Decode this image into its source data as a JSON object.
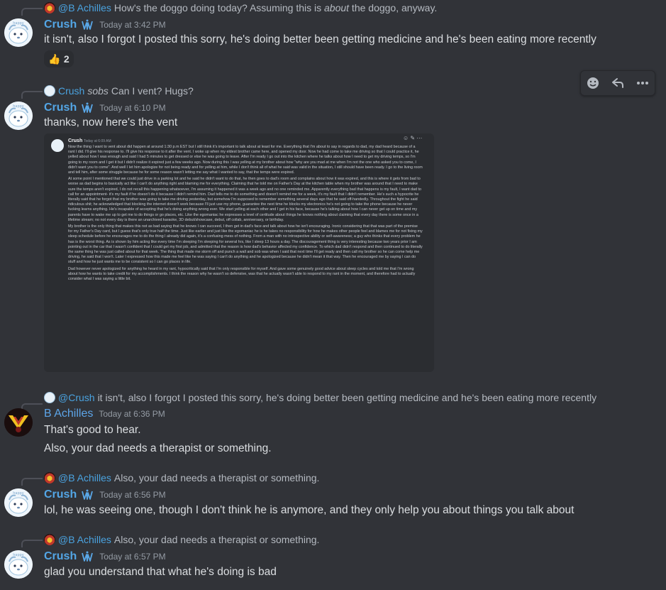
{
  "messages": [
    {
      "reply": {
        "author": "@B Achilles",
        "text_pre": "How's the doggo doing today? Assuming this is ",
        "text_em": "about",
        "text_post": " the doggo, anyway."
      },
      "author": "Crush",
      "timestamp": "Today at 3:42 PM",
      "text": "it isn't, also I forgot I posted this sorry, he's doing better been getting medicine and he's been eating more recently",
      "reaction": {
        "emoji": "👍",
        "count": "2"
      }
    },
    {
      "reply": {
        "author": "Crush",
        "text_em": "sobs",
        "text_post": " Can I vent? Hugs?"
      },
      "author": "Crush",
      "timestamp": "Today at 6:10 PM",
      "text": "thanks, now here's the vent",
      "attachment": {
        "author": "Crush",
        "timestamp": "Today at 6:09 AM",
        "paragraphs": [
          "Now the thing I want to vent about did happen at around 1:30 p.m EST but I still think it's important to talk about at least for me. Everything that I'm about to say in regards to dad, my dad heard because of a rant I did. I'll give his response to. I'll give his response to it after the vent. I woke up when my eldest brother came here, and opened my door. Now he had come to take me driving so that I could practice it, he yelled about how I was enough and said I had 5 minutes to get dressed or else he was going to leave. After I'm ready I go out into the kitchen where he talks about how I need to get my driving temps, so I'm going to my room and I get it but I didn't realize it expired just a few weeks ago. Now during this I was yelling at my brother about how \"why are you mad at me when I'm not the one who asked you to come, I didn't want you to come\". And well I let him apologize for not being ready and for yelling at him, while I don't think all of what he said was valid in the situation, I still should have been ready. I go to the living room and tell him, after some struggle because he for some reason wasn't letting me say what I wanted to say, that the temps were expired.",
          "At some point I mentioned that we could just drive in a parking lot and he said he didn't want to do that, he then goes to dad's room and complains about how it was expired, and this is where it gets from bad to worse as dad begins to basically act like I can't do anything right and blaming me for everything. Claiming that he told me on Father's Day at the kitchen table when my brother was around that I need to make sure the temps aren't expired, I do not recall this happening whatsoever, I'm assuming it happened it was a week ago and no one reminded me. Apparently everything bad that happens is my fault, I want dad to call for an appointment- it's my fault if he doesn't do it because I didn't remind him. Dad tells me to do something and doesn't remind me for a week, it's my fault that I didn't remember. He's such a hypocrite he literally said that he forgot that my brother was going to take me driving yesterday, but somehow I'm supposed to remember something several days ago that he said off-handedly. Throughout the fight he said ridiculous shit; he acknowledged that blocking the internet doesn't work because I'll just use my phone, guarantee the next time he blocks my electronics he's not going to take the phone because he never fucking learns anything. He's incapable of accepting that he's doing anything wrong ever. We start yelling at each other and I get in his face, because he's talking about how I can never get up on time and my parents have to wake me up to get me to do things or go places, etc. Like the egomaniac he expresses a level of certitude about things he knows nothing about claiming that every day there is some once in a lifetime stream; no not every day is there an unarchived karaoke, 3D debut/showcase, debut, off collab, anniversary, or birthday.",
          "My brother is the only thing that makes this not as bad saying that he knows I can succeed, I then get in dad's face and talk about how he isn't encouraging. Ironic considering that that was part of the premise for my Father's Day card, but I guess that's only true half the time. Just like earlier and just like the egomaniac he is he takes no responsibility for how he makes other people feel and blames me for not fixing my sleep schedule before he encourages me to do the thing I already did again, it's a confusing mess of nothing. From a man with no introspective ability or self-awareness; a guy who thinks that every problem he has is the worst thing. As is shown by him acting like every time I'm sleeping I'm sleeping for several hrs, like I sleep 13 hours a day. The discouragement thing is very interesting because two years prior I am pointing out in the car that I wasn't confident that I could get my first job, and admitted that the reason is how dad's behavior affected my confidence. To which dad didn't respond and then continued to do literally the same thing he was just called about for that week. The thing that made me storm off and punch a wall and sob was when I said that next time I'll get ready and then call my brother so he can come help me driving, he said that I won't. Later I expressed how this made me feel like he was saying I can't do anything and he apologized because he didn't mean it that way. Then he encouraged me by saying I can do stuff and how he just wants me to be consistent so I can go places in life.",
          "Dad however never apologized for anything he heard in my rant, hypocritically said that I'm only responsible for myself. And gave some genuinely good advice about sleep cycles and told me that I'm wrong about how he wants to take credit for my accomplishments. I think the reason why he wasn't so defensive, was that he actually wasn't able to respond to my rant in the moment, and therefore had to actually consider what I was saying a little bit."
        ]
      }
    },
    {
      "reply": {
        "author": "@Crush",
        "text_post": "it isn't, also I forgot I posted this sorry, he's doing better been getting medicine and he's been eating more recently"
      },
      "author": "B Achilles",
      "timestamp": "Today at 6:36 PM",
      "lines": [
        "That's good to hear.",
        "Also, your dad needs a therapist or something."
      ]
    },
    {
      "reply": {
        "author": "@B Achilles",
        "text_post": "Also, your dad needs a therapist or something."
      },
      "author": "Crush",
      "timestamp": "Today at 6:56 PM",
      "text": "lol, he was seeing one, though I don't think he is anymore, and they only help you about things you talk about"
    },
    {
      "reply": {
        "author": "@B Achilles",
        "text_post": "Also, your dad needs a therapist or something."
      },
      "author": "Crush",
      "timestamp": "Today at 6:57 PM",
      "text": "glad you understand that what he's doing is bad"
    }
  ],
  "toolbar": {
    "icons": [
      "add-reaction-icon",
      "reply-icon",
      "more-icon"
    ]
  },
  "colors": {
    "background": "#313338",
    "crush_name": "#53a6e6",
    "achilles_name": "#5da5e8",
    "muted": "#949ba4"
  }
}
